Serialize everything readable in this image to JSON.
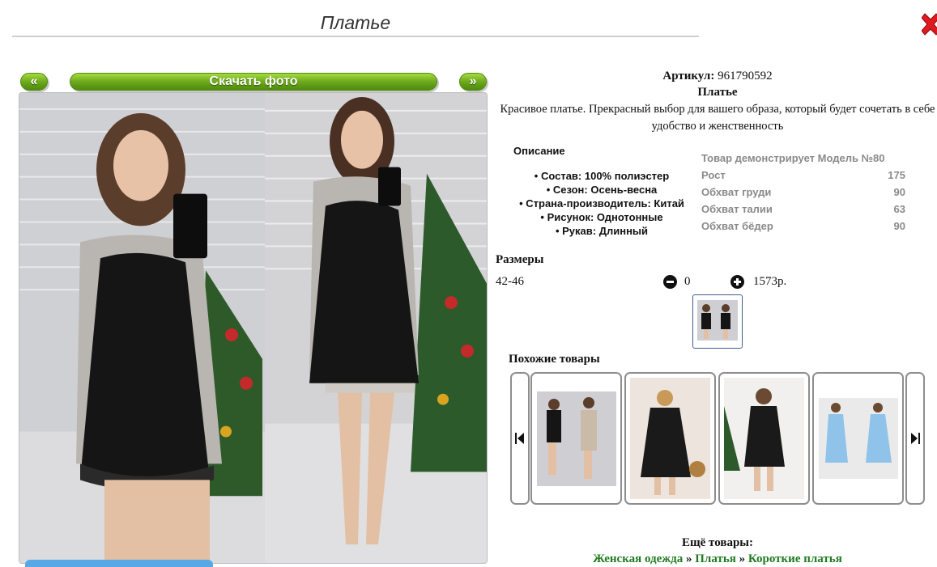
{
  "page": {
    "title": "Платье"
  },
  "gallery": {
    "prev_label": "«",
    "download_label": "Скачать фото",
    "next_label": "»"
  },
  "product": {
    "article_label": "Артикул:",
    "article_value": "961790592",
    "name": "Платье",
    "description": "Красивое платье. Прекрасный выбор для вашего образа, который будет сочетать в себе удобство и женственность"
  },
  "description_block": {
    "heading": "Описание",
    "items": [
      "Состав: 100% полиэстер",
      "Сезон: Осень-весна",
      "Страна-производитель: Китай",
      "Рисунок: Однотонные",
      "Рукав: Длинный"
    ]
  },
  "model_info": {
    "title": "Товар демонстрирует Модель №80",
    "rows": [
      {
        "label": "Рост",
        "value": "175"
      },
      {
        "label": "Обхват груди",
        "value": "90"
      },
      {
        "label": "Обхват талии",
        "value": "63"
      },
      {
        "label": "Обхват бёдер",
        "value": "90"
      }
    ]
  },
  "sizes": {
    "heading": "Размеры",
    "size": "42-46",
    "quantity": "0",
    "price": "1573р."
  },
  "similar": {
    "heading": "Похожие товары"
  },
  "more": {
    "heading": "Ещё товары:",
    "links": [
      "Женская одежда",
      "Платья",
      "Короткие платья"
    ],
    "separator": "»"
  },
  "colors": {
    "button_green": "#6aa51b",
    "link_green": "#1f7a1f",
    "close_red": "#e0191f",
    "bar_blue": "#56a9e6"
  },
  "icons": {
    "close": "close-icon",
    "minus": "minus-circle-icon",
    "plus": "plus-circle-icon",
    "carousel_prev": "skip-back-icon",
    "carousel_next": "skip-forward-icon"
  }
}
